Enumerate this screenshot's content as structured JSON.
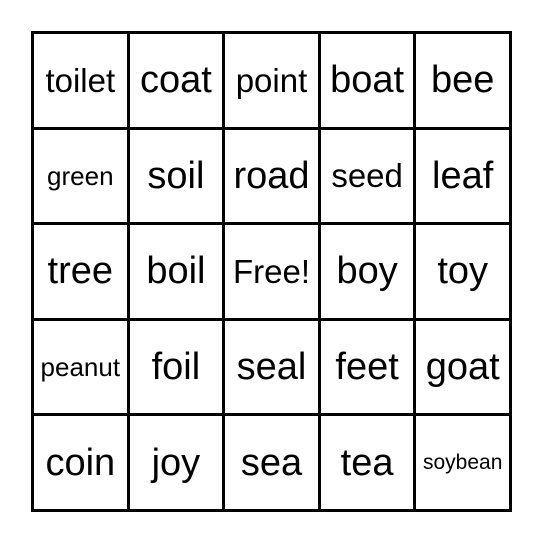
{
  "card": {
    "type": "bingo-card",
    "rows": 5,
    "columns": 5,
    "free_space_label": "Free!",
    "free_space_position": {
      "row": 3,
      "column": 3
    },
    "colors": {
      "background": "#ffffff",
      "border": "#000000",
      "text": "#000000"
    },
    "cells": [
      [
        {
          "label": "toilet",
          "size": "md"
        },
        {
          "label": "coat",
          "size": "lg"
        },
        {
          "label": "point",
          "size": "md"
        },
        {
          "label": "boat",
          "size": "lg"
        },
        {
          "label": "bee",
          "size": "lg"
        }
      ],
      [
        {
          "label": "green",
          "size": "sm"
        },
        {
          "label": "soil",
          "size": "lg"
        },
        {
          "label": "road",
          "size": "lg"
        },
        {
          "label": "seed",
          "size": "md"
        },
        {
          "label": "leaf",
          "size": "lg"
        }
      ],
      [
        {
          "label": "tree",
          "size": "lg"
        },
        {
          "label": "boil",
          "size": "lg"
        },
        {
          "label": "Free!",
          "size": "md"
        },
        {
          "label": "boy",
          "size": "lg"
        },
        {
          "label": "toy",
          "size": "lg"
        }
      ],
      [
        {
          "label": "peanut",
          "size": "sm"
        },
        {
          "label": "foil",
          "size": "lg"
        },
        {
          "label": "seal",
          "size": "lg"
        },
        {
          "label": "feet",
          "size": "lg"
        },
        {
          "label": "goat",
          "size": "lg"
        }
      ],
      [
        {
          "label": "coin",
          "size": "lg"
        },
        {
          "label": "joy",
          "size": "lg"
        },
        {
          "label": "sea",
          "size": "lg"
        },
        {
          "label": "tea",
          "size": "lg"
        },
        {
          "label": "soybean",
          "size": "xs"
        }
      ]
    ]
  }
}
